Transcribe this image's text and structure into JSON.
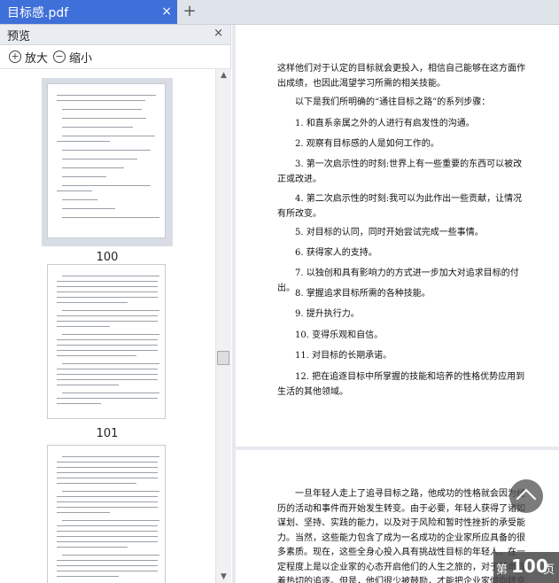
{
  "tab": {
    "title": "目标感.pdf",
    "close": "×",
    "add": "+"
  },
  "sidebar": {
    "title": "预览",
    "close": "×",
    "zoom_in_label": "放大",
    "zoom_out_label": "缩小",
    "thumbnails": [
      {
        "page": "100",
        "selected": true
      },
      {
        "page": "101",
        "selected": false
      },
      {
        "page": "",
        "selected": false
      }
    ]
  },
  "document": {
    "page1_paragraphs": [
      "这样他们对于认定的目标就会更投入，相信自己能够在这方面作出成绩，也因此渴望学习所需的相关技能。",
      "以下是我们所明确的“通往目标之路”的系列步骤：",
      "1. 和直系亲属之外的人进行有启发性的沟通。",
      "2. 观察有目标感的人是如何工作的。",
      "3. 第一次启示性的时刻:世界上有一些重要的东西可以被改正或改进。",
      "4. 第二次启示性的时刻:我可以为此作出一些贡献，让情况有所改变。",
      "5. 对目标的认同，同时开始尝试完成一些事情。",
      "6. 获得家人的支持。",
      "7. 以独创和具有影响力的方式进一步加大对追求目标的付出。",
      "8. 掌握追求目标所需的各种技能。",
      "9. 提升执行力。",
      "10. 变得乐观和自信。",
      "11. 对目标的长期承诺。",
      "12. 把在追逐目标中所掌握的技能和培养的性格优势应用到生活的其他领域。"
    ],
    "page2_paragraph": "一旦年轻人走上了追寻目标之路，他成功的性格就会因为经历的活动和事件而开始发生转变。由于必要，年轻人获得了诸如谋划、坚持、实践的能力，以及对于风险和暂时性挫折的承受能力。当然，这些能力包含了成为一名成功的企业家所应具备的很多素质。现在，这些全身心投入具有挑战性目标的年轻人，在一定程度上是以企业家的心态开启他们的人生之旅的，对于使命有着热切的追逐。但是，他们很少被鼓励，才能把企业家倾向转变为成熟的企业家精神，填补了当"
  },
  "overlay": {
    "page_prefix": "第",
    "page_number": "100",
    "page_suffix": "页"
  }
}
